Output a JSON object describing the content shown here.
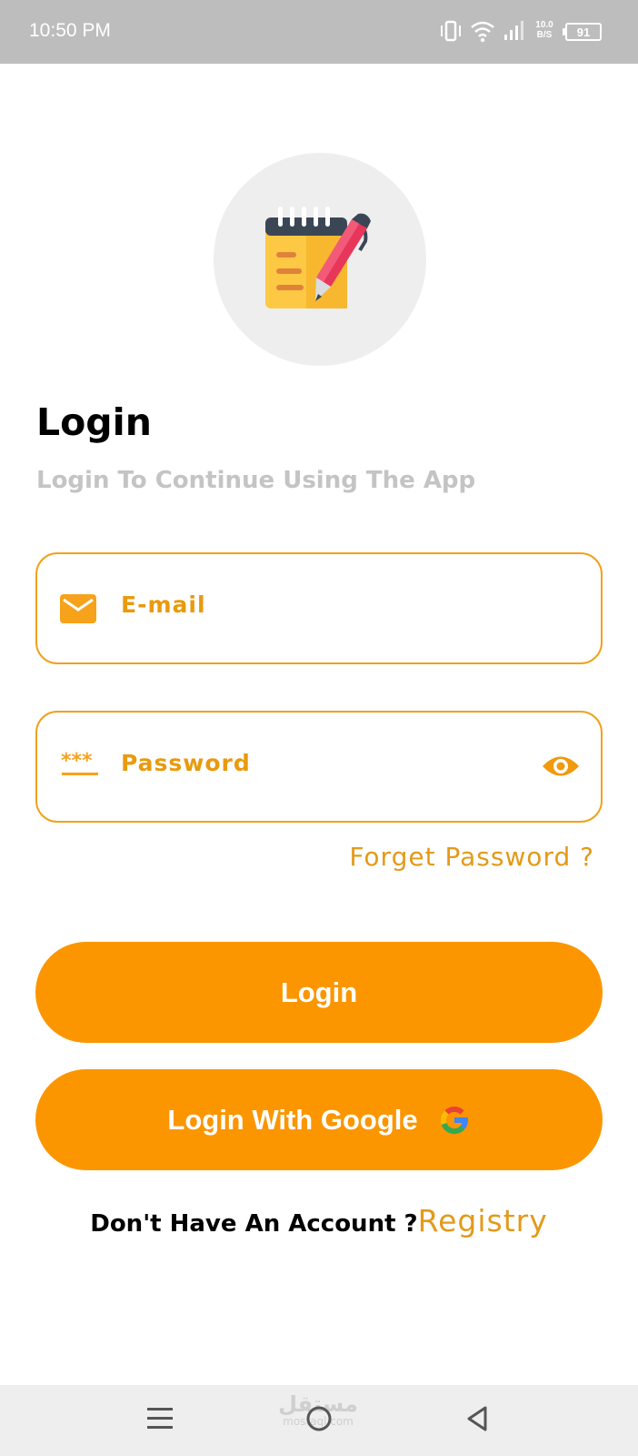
{
  "status_bar": {
    "time": "10:50 PM",
    "net_speed_value": "10.0",
    "net_speed_unit": "B/S",
    "battery": "91",
    "icons": [
      "vibrate-icon",
      "wifi-icon",
      "signal-icon",
      "battery-icon"
    ]
  },
  "logo": {
    "icon": "notepad-pen-icon"
  },
  "header": {
    "title": "Login",
    "subtitle": "Login To Continue Using The App"
  },
  "form": {
    "email": {
      "placeholder": "E-mail",
      "value": "",
      "icon": "mail-icon"
    },
    "password": {
      "placeholder": "Password",
      "value": "",
      "icon": "password-dots-icon",
      "toggle_icon": "eye-icon"
    },
    "forget_label": "Forget Password  ?"
  },
  "buttons": {
    "login_label": "Login",
    "google_label": "Login With Google",
    "google_icon": "google-icon"
  },
  "register": {
    "prompt": "Don't Have An Account ?",
    "link": "Registry"
  },
  "nav_bar": {
    "watermark": "مستقل",
    "watermark_sub": "mostaql.com",
    "icons": [
      "menu-icon",
      "home-icon",
      "back-icon"
    ]
  },
  "colors": {
    "accent": "#fb9600",
    "accent_text": "#e39a19",
    "field_border": "#f0a21b",
    "subtitle": "#c4c4c4",
    "status_bar": "#bdbdbd"
  }
}
